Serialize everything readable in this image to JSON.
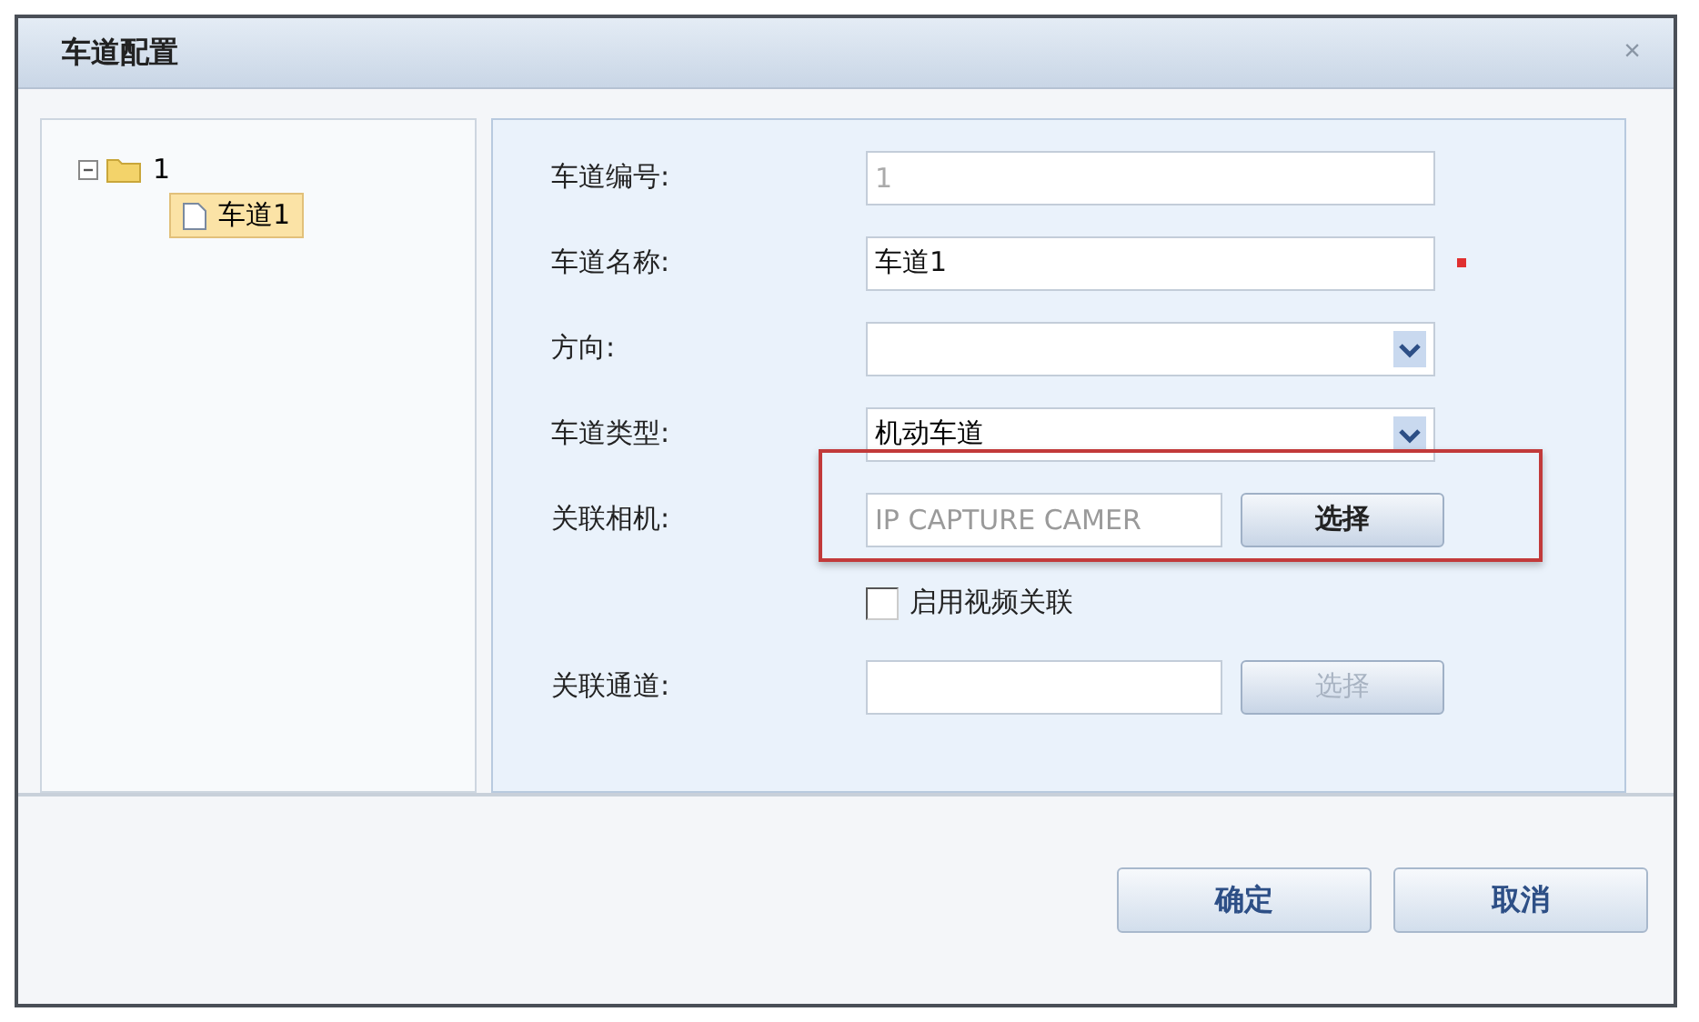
{
  "window": {
    "title": "车道配置",
    "close": "×"
  },
  "tree": [
    {
      "label": "1",
      "expanded": true,
      "selected": false,
      "children": [
        {
          "label": "车道1",
          "selected": true
        }
      ]
    }
  ],
  "form": [
    {
      "kind": "text",
      "label": "车道编号:",
      "value": "1",
      "disabled": true,
      "required": false
    },
    {
      "kind": "text",
      "label": "车道名称:",
      "value": "车道1",
      "disabled": false,
      "required": true
    },
    {
      "kind": "select",
      "label": "方向:"
    },
    {
      "kind": "select",
      "label": "车道类型:",
      "value": "机动车道"
    },
    {
      "kind": "picker",
      "label": "关联相机:",
      "placeholder": "IP CAPTURE CAMER",
      "button": "选择",
      "disabled": false,
      "highlighted": true
    },
    {
      "kind": "checkbox",
      "label": "启用视频关联",
      "checked": false
    },
    {
      "kind": "picker",
      "label": "关联通道:",
      "button": "选择",
      "disabled": true,
      "highlighted": false
    }
  ],
  "buttons": [
    "确定",
    "取消"
  ]
}
